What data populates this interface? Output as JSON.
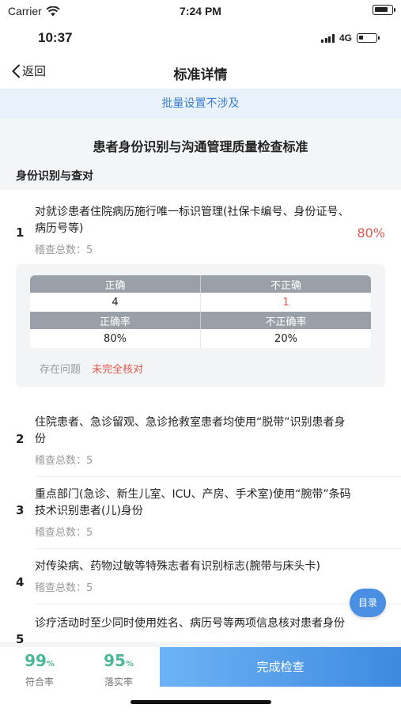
{
  "outer_status": {
    "carrier": "Carrier",
    "time": "7:24 PM"
  },
  "inner_status": {
    "time": "10:37",
    "network": "4G"
  },
  "nav": {
    "back_label": "返回",
    "title": "标准详情"
  },
  "batch": {
    "label": "批量设置不涉及"
  },
  "document": {
    "title": "患者身份识别与沟通管理质量检查标准",
    "section_title": "身份识别与查对",
    "items": [
      {
        "num": "1",
        "text": "对就诊患者住院病历施行唯一标识管理(社保卡编号、身份证号、病历号等)",
        "meta": "稽查总数：5",
        "rate": "80%"
      },
      {
        "num": "2",
        "text": "住院患者、急诊留观、急诊抢救室患者均使用“脱带”识别患者身份",
        "meta": "稽查总数：5"
      },
      {
        "num": "3",
        "text": "重点部门(急诊、新生儿室、ICU、产房、手术室)使用“腕带”条码技术识别患者(儿)身份",
        "meta": "稽查总数：5"
      },
      {
        "num": "4",
        "text": "对传染病、药物过敏等特殊志者有识别标志(腕带与床头卡)",
        "meta": "稽查总数：5"
      },
      {
        "num": "5",
        "text": "诊疗活动时至少同时使用姓名、病历号等两项信息核对患者身份"
      }
    ],
    "detail": {
      "col_correct": "正确",
      "col_incorrect": "不正确",
      "correct_count": "4",
      "incorrect_count": "1",
      "col_correct_rate": "正确率",
      "col_incorrect_rate": "不正确率",
      "correct_rate": "80%",
      "incorrect_rate": "20%",
      "problem_label": "存在问题",
      "problem_value": "未完全核对"
    }
  },
  "toc_button": {
    "label": "目录"
  },
  "bottom": {
    "compliance_value": "99",
    "compliance_unit": "%",
    "compliance_label": "符合率",
    "implementation_value": "95",
    "implementation_unit": "%",
    "implementation_label": "落实率",
    "complete_label": "完成检查"
  },
  "colors": {
    "accent_blue": "#3d8ae0",
    "red": "#e0584e",
    "green": "#4bb796"
  },
  "battery": {
    "outer_level": 0.85,
    "inner_level": 0.25
  }
}
